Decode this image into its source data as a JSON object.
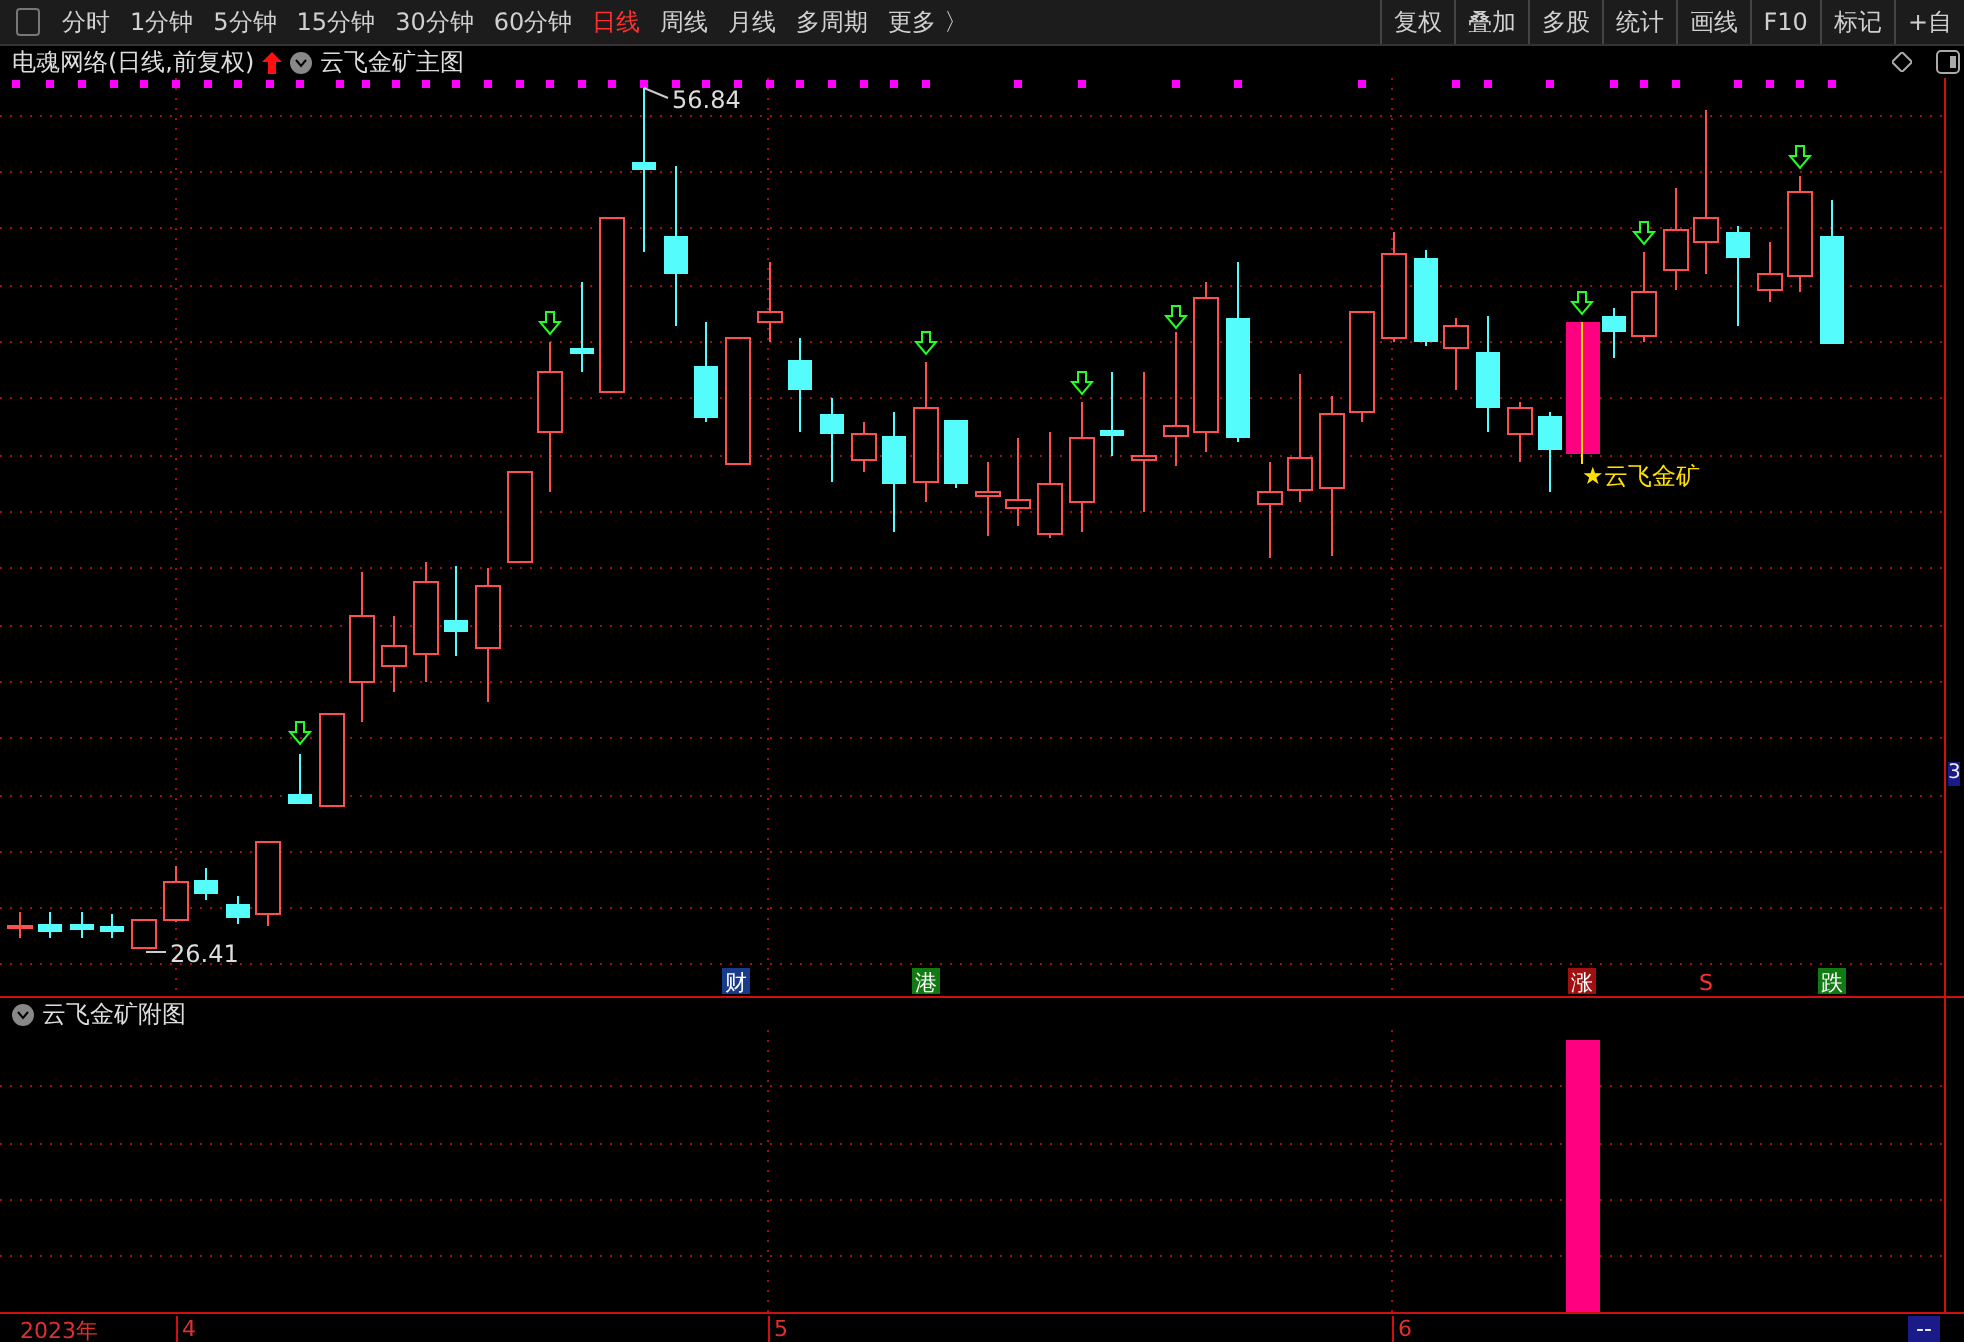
{
  "toolbar": {
    "periods": [
      {
        "label": "分时",
        "selected": false
      },
      {
        "label": "1分钟",
        "selected": false
      },
      {
        "label": "5分钟",
        "selected": false
      },
      {
        "label": "15分钟",
        "selected": false
      },
      {
        "label": "30分钟",
        "selected": false
      },
      {
        "label": "60分钟",
        "selected": false
      },
      {
        "label": "日线",
        "selected": true
      },
      {
        "label": "周线",
        "selected": false
      },
      {
        "label": "月线",
        "selected": false
      },
      {
        "label": "多周期",
        "selected": false
      },
      {
        "label": "更多 〉",
        "selected": false
      }
    ],
    "buttons": [
      "复权",
      "叠加",
      "多股",
      "统计",
      "画线",
      "F10",
      "标记",
      "+自"
    ]
  },
  "main_chart": {
    "title": "电魂网络(日线,前复权)",
    "indicator": "云飞金矿主图",
    "high_label": "56.84",
    "low_label": "26.41",
    "signal_label": "★云飞金矿",
    "price_tag": "3",
    "markers": [
      {
        "text": "财",
        "kind": "badge",
        "color": "#1a3a8a"
      },
      {
        "text": "港",
        "kind": "badge",
        "color": "#127a12"
      },
      {
        "text": "涨",
        "kind": "badge",
        "color": "#a01010"
      },
      {
        "text": "S",
        "kind": "plain",
        "color": "#ff3030"
      },
      {
        "text": "跌",
        "kind": "badge",
        "color": "#127a12"
      }
    ]
  },
  "sub_chart": {
    "title": "云飞金矿附图"
  },
  "time_axis": {
    "labels": [
      "2023年",
      "4",
      "5",
      "6"
    ],
    "corner": "--"
  }
}
